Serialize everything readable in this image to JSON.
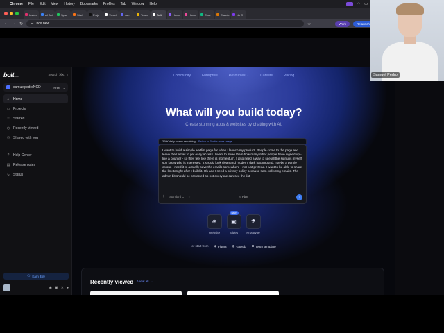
{
  "menubar": {
    "app": "Chrome",
    "items": [
      "File",
      "Edit",
      "View",
      "History",
      "Bookmarks",
      "Profiles",
      "Tab",
      "Window",
      "Help"
    ]
  },
  "tabs": [
    "Instan",
    "AI Bui",
    "Spac",
    "Start",
    "Proje",
    "Vercel",
    "sam",
    "Team",
    "Bolt",
    "Home",
    "Home",
    "Chat",
    "Claude",
    "No C"
  ],
  "browser": {
    "url": "bolt.new",
    "profile": "Work",
    "relaunch": "Relaunch"
  },
  "sidebar": {
    "logo": "bolt",
    "logo_sub": ".new",
    "search": "Search ⌘K",
    "account": "samuelpedroNCD",
    "plan": "Free",
    "items": [
      {
        "label": "Home",
        "icon": "⌂"
      },
      {
        "label": "Projects",
        "icon": "▭"
      },
      {
        "label": "Starred",
        "icon": "☆"
      },
      {
        "label": "Recently viewed",
        "icon": "◷"
      },
      {
        "label": "Shared with you",
        "icon": "⚇"
      }
    ],
    "items2": [
      {
        "label": "Help Center",
        "icon": "?"
      },
      {
        "label": "Release notes",
        "icon": "▤"
      },
      {
        "label": "Status",
        "icon": "∿"
      }
    ],
    "earn": "Earn $50"
  },
  "topnav": [
    "Community",
    "Enterprise",
    "Resources ⌄",
    "Careers",
    "Pricing"
  ],
  "hero": {
    "title": "What will you build today?",
    "subtitle": "Create stunning apps & websites by chatting with AI."
  },
  "prompt": {
    "tokens": "300K daily tokens remaining.",
    "tokens_link": "Switch to Pro for more usage",
    "text": "I want to build a simple waitlist page for when I launch my product. People come to the page and leave their email to get early access. I want to show them how many other people have signed up - like a counter - so they feel like there is momentum. I also need a way to see all the signups myself so I know who is interested. It should look clean and modern, dark background, maybe a purple colour. I need it to actually save the emails somewhere - not just pretend. I want to be able to share the link tonight after I build it. Oh and I need a privacy policy because I am collecting emails. The admin bit should be protected so not everyone can see the list.",
    "model": "Standard",
    "plan": "Plan",
    "plus": "+"
  },
  "cards": [
    {
      "label": "Website",
      "icon": "⊕",
      "badge": ""
    },
    {
      "label": "Slides",
      "icon": "▣",
      "badge": "New"
    },
    {
      "label": "Prototype",
      "icon": "⚗",
      "badge": ""
    }
  ],
  "starts": {
    "lead": "or start from",
    "options": [
      "Figma",
      "GitHub",
      "Team template"
    ]
  },
  "recent": {
    "title": "Recently viewed",
    "view_all": "View all →"
  },
  "webcam": {
    "name": "Samuel Pedro"
  },
  "colors": {
    "accent": "#3f7df3",
    "link": "#6d8cff",
    "sidebar_bg": "#111114"
  }
}
